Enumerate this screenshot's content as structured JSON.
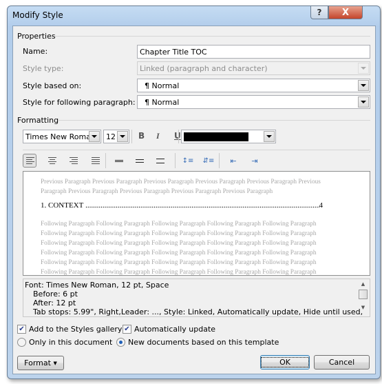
{
  "window": {
    "title": "Modify Style",
    "help_label": "?",
    "close_label": "X"
  },
  "properties": {
    "group_label": "Properties",
    "name_label": "Name:",
    "name_value": "Chapter Title TOC",
    "style_type_label": "Style type:",
    "style_type_value": "Linked (paragraph and character)",
    "based_on_label": "Style based on:",
    "based_on_value": "Normal",
    "following_label": "Style for following paragraph:",
    "following_value": "Normal",
    "paragraph_mark": "¶"
  },
  "formatting": {
    "group_label": "Formatting",
    "font": "Times New Roman",
    "size": "12",
    "bold": "B",
    "italic": "I",
    "underline": "U",
    "font_color": "#000000",
    "alignment_selected": "align-left"
  },
  "preview": {
    "previous_lines": [
      "Previous Paragraph Previous Paragraph Previous Paragraph Previous Paragraph Previous Paragraph Previous",
      "Paragraph Previous Paragraph Previous Paragraph Previous Paragraph Previous Paragraph"
    ],
    "toc_entry": "1. CONTEXT",
    "toc_page": "4",
    "following_line": "Following Paragraph Following Paragraph Following Paragraph Following Paragraph Following Paragraph"
  },
  "description": {
    "lines": [
      "Font: Times New Roman, 12 pt, Space",
      "   Before:  6 pt",
      "   After:  12 pt",
      "   Tab stops:  5.99\", Right,Leader: ..., Style: Linked, Automatically update, Hide until used,"
    ]
  },
  "options": {
    "add_to_gallery": "Add to the Styles gallery",
    "add_to_gallery_checked": true,
    "auto_update": "Automatically update",
    "auto_update_checked": true,
    "only_this_doc": "Only in this document",
    "new_docs": "New documents based on this template",
    "selected_scope": "new_docs"
  },
  "buttons": {
    "format": "Format",
    "ok": "OK",
    "cancel": "Cancel"
  }
}
